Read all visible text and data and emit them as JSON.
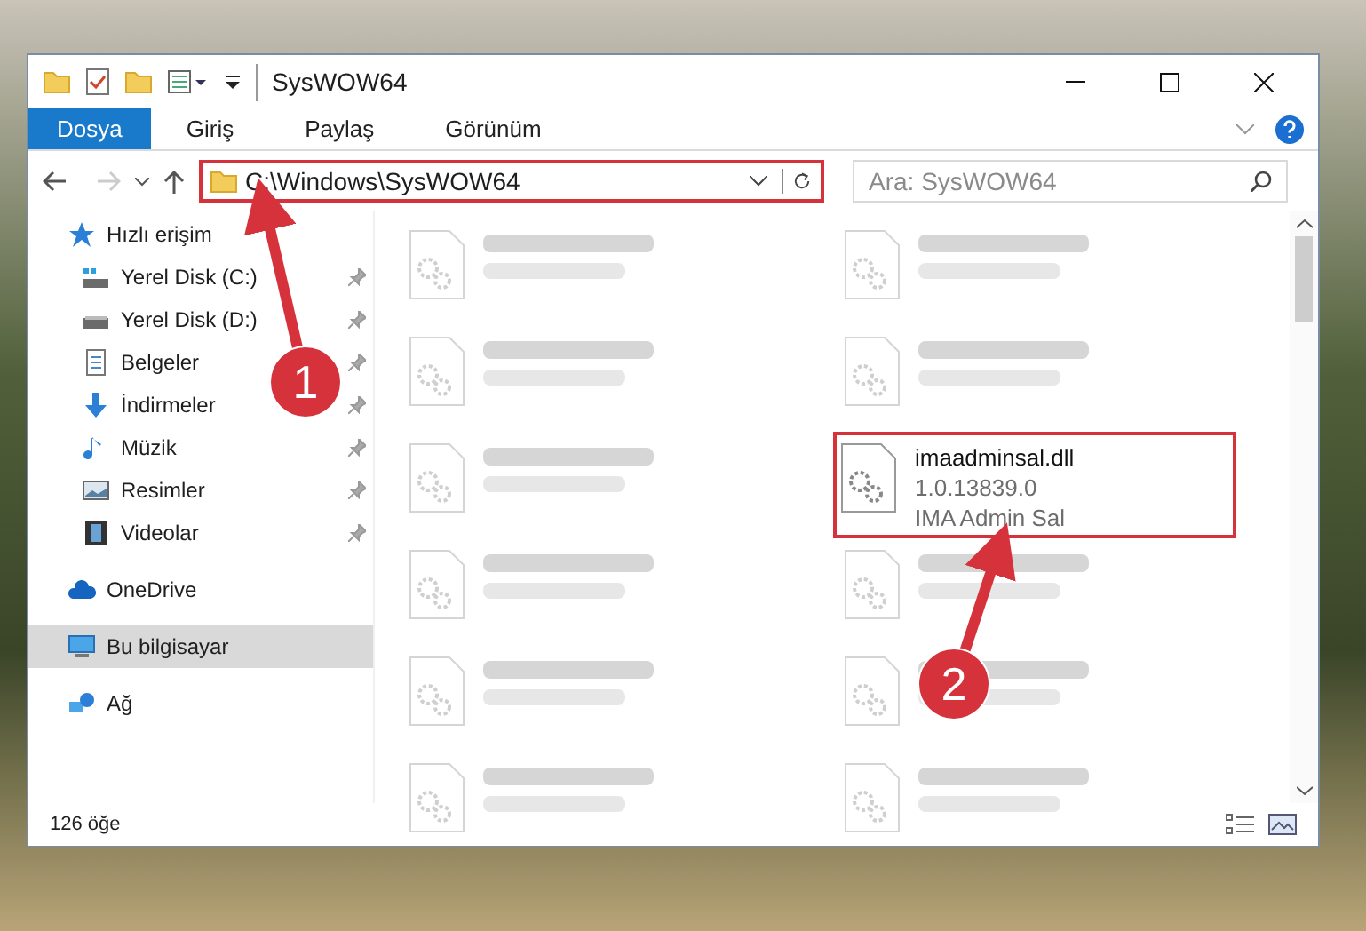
{
  "window": {
    "title": "SysWOW64"
  },
  "ribbon_tabs": [
    {
      "label": "Dosya",
      "selected": true
    },
    {
      "label": "Giriş",
      "selected": false
    },
    {
      "label": "Paylaş",
      "selected": false
    },
    {
      "label": "Görünüm",
      "selected": false
    }
  ],
  "address_bar": {
    "path": "C:\\Windows\\SysWOW64",
    "highlighted": true
  },
  "search": {
    "placeholder": "Ara: SysWOW64"
  },
  "sidebar": {
    "items": [
      {
        "label": "Hızlı erişim",
        "kind": "star",
        "selected": false,
        "children": [
          {
            "label": "Yerel Disk (C:)",
            "kind": "drive-c",
            "selected": false
          },
          {
            "label": "Yerel Disk (D:)",
            "kind": "drive",
            "selected": false
          },
          {
            "label": "Belgeler",
            "kind": "document",
            "selected": false
          },
          {
            "label": "İndirmeler",
            "kind": "download",
            "selected": false
          },
          {
            "label": "Müzik",
            "kind": "music",
            "selected": false
          },
          {
            "label": "Resimler",
            "kind": "pictures",
            "selected": false
          },
          {
            "label": "Videolar",
            "kind": "video",
            "selected": false
          }
        ]
      },
      {
        "label": "OneDrive",
        "kind": "cloud",
        "selected": false
      },
      {
        "label": "Bu bilgisayar",
        "kind": "computer",
        "selected": true
      },
      {
        "label": "Ağ",
        "kind": "network",
        "selected": false
      }
    ]
  },
  "files": [
    {
      "blurred": true,
      "highlighted": false
    },
    {
      "blurred": true,
      "highlighted": false
    },
    {
      "blurred": true,
      "highlighted": false
    },
    {
      "blurred": true,
      "highlighted": false
    },
    {
      "blurred": true,
      "highlighted": false
    },
    {
      "name": "imaadminsal.dll",
      "lines": [
        "1.0.13839.0",
        "IMA Admin Sal"
      ],
      "blurred": false,
      "highlighted": true
    },
    {
      "blurred": true,
      "highlighted": false
    },
    {
      "blurred": true,
      "highlighted": false
    },
    {
      "blurred": true,
      "highlighted": false
    },
    {
      "blurred": true,
      "highlighted": false
    },
    {
      "blurred": true,
      "highlighted": false
    },
    {
      "blurred": true,
      "highlighted": false
    }
  ],
  "status_bar": {
    "item_count": "126 öğe"
  },
  "annotations": [
    {
      "number": "1"
    },
    {
      "number": "2"
    }
  ]
}
